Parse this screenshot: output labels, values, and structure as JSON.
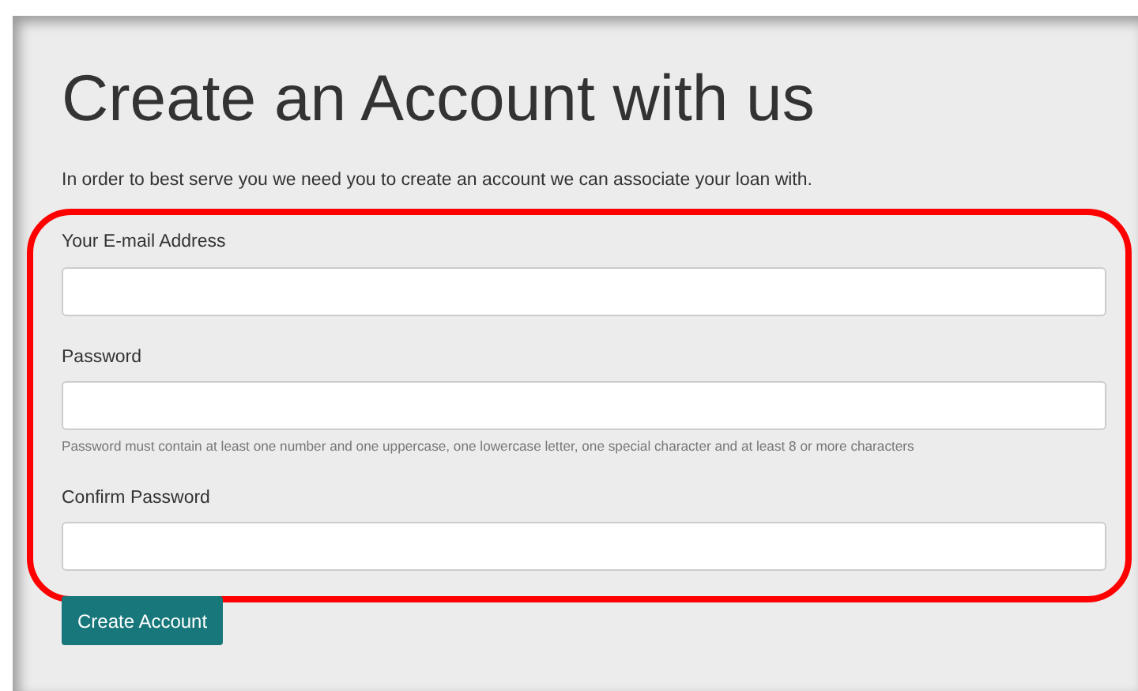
{
  "heading": "Create an Account with us",
  "intro": "In order to best serve you we need you to create an account we can associate your loan with.",
  "fields": [
    {
      "label": "Your E-mail Address"
    },
    {
      "label": "Password",
      "help": "Password must contain at least one number and one uppercase, one lowercase letter, one special character and at least 8 or more characters"
    },
    {
      "label": "Confirm Password"
    }
  ],
  "submit_button": "Create Account"
}
